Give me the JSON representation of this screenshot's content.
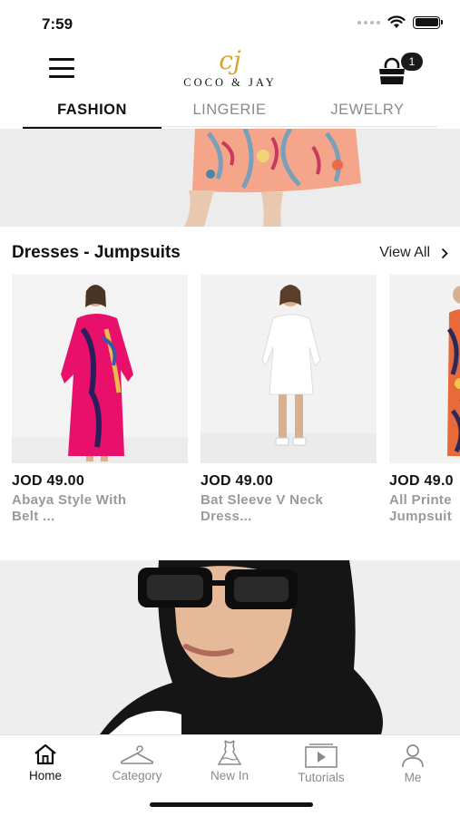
{
  "status_bar": {
    "time": "7:59",
    "icons": [
      "signal-dots-icon",
      "wifi-icon",
      "battery-icon"
    ]
  },
  "header": {
    "menu_icon": "hamburger-menu-icon",
    "logo_mark": "cj",
    "logo_text": "COCO & JAY",
    "cart_icon": "shopping-bag-icon",
    "cart_count": "1"
  },
  "tabs": [
    {
      "label": "FASHION",
      "active": true
    },
    {
      "label": "LINGERIE",
      "active": false
    },
    {
      "label": "JEWELRY",
      "active": false
    }
  ],
  "section": {
    "title": "Dresses - Jumpsuits",
    "view_all": "View All",
    "view_all_icon": "chevron-right-icon"
  },
  "products": [
    {
      "price": "JOD 49.00",
      "name_line1": "Abaya Style With",
      "name_line2": "Belt ..."
    },
    {
      "price": "JOD 49.00",
      "name_line1": "Bat Sleeve V Neck",
      "name_line2": "Dress..."
    },
    {
      "price": "JOD 49.0",
      "name_line1": "All Printe",
      "name_line2": "Jumpsuit"
    }
  ],
  "bottom_nav": [
    {
      "label": "Home",
      "icon": "home-icon",
      "active": true
    },
    {
      "label": "Category",
      "icon": "hanger-icon",
      "active": false
    },
    {
      "label": "New In",
      "icon": "dress-icon",
      "active": false
    },
    {
      "label": "Tutorials",
      "icon": "video-play-icon",
      "active": false
    },
    {
      "label": "Me",
      "icon": "user-icon",
      "active": false
    }
  ],
  "colors": {
    "logo_gold": "#d9a52a",
    "accent_pink": "#e8106a",
    "muted_text": "#9a9a9a"
  }
}
